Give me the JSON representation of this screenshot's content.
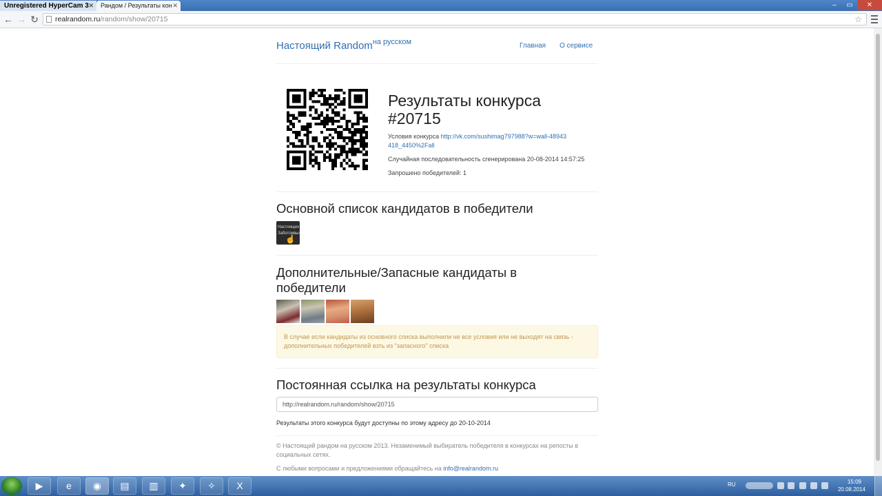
{
  "browser": {
    "tab_hypercam": "Unregistered HyperCam 3",
    "tab_active": "Рандом / Результаты кон",
    "url_host": "realrandom.ru",
    "url_path": "/random/show/20715"
  },
  "page": {
    "brand": "Настоящий Random",
    "brand_sup": "на русском",
    "nav_home": "Главная",
    "nav_about": "О сервисе",
    "title": "Результаты конкурса #20715",
    "conditions_label": "Условия конкурса",
    "conditions_link": "http://vk.com/sushimag797988?w=wall-48943418_4450%2Fall",
    "generated": "Случайная последовательность сгенерирована 20-08-2014 14:57:25",
    "winners_requested": "Запрошено победителей: 1",
    "main_list_heading": "Основной список кандидатов в победители",
    "main_avatar_caption": "Настоящих Заботливых",
    "reserve_heading": "Дополнительные/Запасные кандидаты в победители",
    "warning": "В случае если кандидаты из основного списка выполнили не все условия или не выходят на связь - дополнительных победителей взть из \"запасного\" списка",
    "permalink_heading": "Постоянная ссылка на результаты конкурса",
    "permalink_value": "http://realrandom.ru/random/show/20715",
    "available_until": "Результаты этого конкурса будут доступны по этому адресу до 20-10-2014",
    "footer_copyright": "© Настоящий рандом на русском 2013. Незаменимый выбиратель победителя в конкурсах на репосты в социальных сетях.",
    "footer_contact": "С любыми вопросами и предложениями обращайтесь на",
    "footer_email": "info@realrandom.ru"
  },
  "taskbar": {
    "lang": "RU",
    "time": "15:09",
    "date": "20.08.2014"
  },
  "colors": {
    "link": "#2f6fb3",
    "warning_bg": "#fcf8e3",
    "warning_text": "#c09853"
  }
}
